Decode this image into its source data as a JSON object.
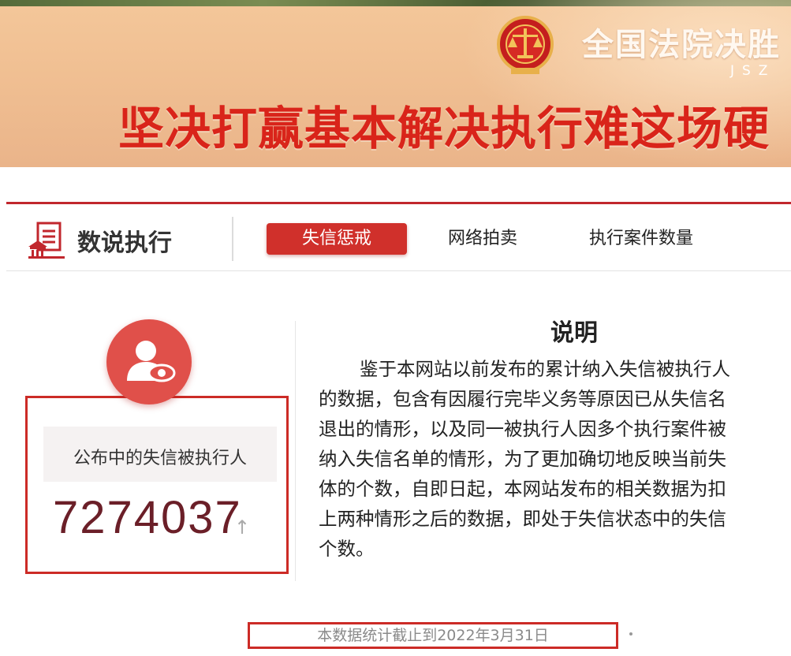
{
  "banner": {
    "court_name": "全国法院决胜",
    "court_sub": "JSZ",
    "slogan": "坚决打赢基本解决执行难这场硬"
  },
  "panel": {
    "title": "数说执行",
    "tabs": [
      {
        "label": "失信惩戒",
        "active": true
      },
      {
        "label": "网络拍卖",
        "active": false
      },
      {
        "label": "执行案件数量",
        "active": false
      }
    ]
  },
  "stat": {
    "label": "公布中的失信被执行人",
    "value": "7274037",
    "trend_icon": "↑"
  },
  "note": {
    "title": "说明",
    "lines": [
      "鉴于本网站以前发布的累计纳入失信被执行人",
      "的数据，包含有因履行完毕义务等原因已从失信名",
      "退出的情形，以及同一被执行人因多个执行案件被",
      "纳入失信名单的情形，为了更加确切地反映当前失",
      "体的个数，自即日起，本网站发布的相关数据为扣",
      "上两种情形之后的数据，即处于失信状态中的失信",
      "个数。"
    ]
  },
  "footer": {
    "date_note": "本数据统计截止到2022年3月31日"
  },
  "colors": {
    "accent_red": "#d0302b",
    "slogan_red": "#d9241a",
    "value_color": "#6b1f28"
  }
}
